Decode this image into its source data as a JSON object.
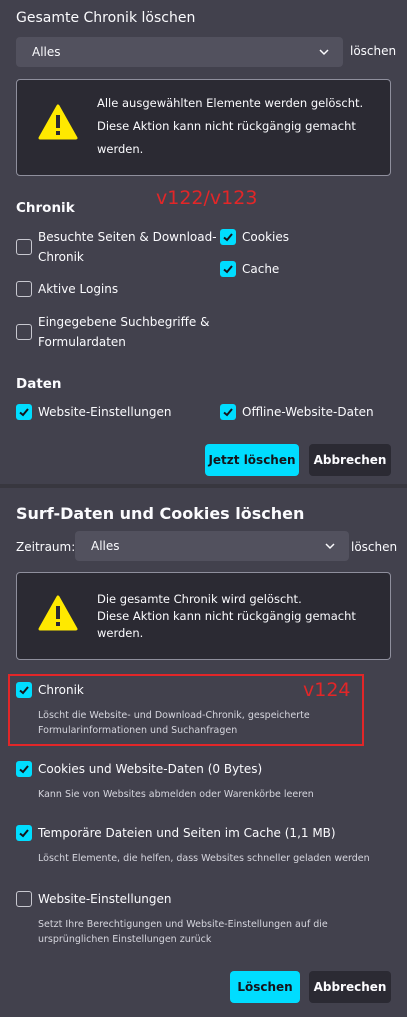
{
  "old_dialog": {
    "title": "Gesamte Chronik löschen",
    "range_value": "Alles",
    "range_suffix": "löschen",
    "warning_line1": "Alle ausgewählten Elemente werden gelöscht.",
    "warning_line2": "Diese Aktion kann nicht rückgängig gemacht",
    "warning_line3": "werden.",
    "version_tag": "v122/v123",
    "history_section": "Chronik",
    "items": [
      {
        "label_line1": "Besuchte Seiten & Download-",
        "label_line2": "Chronik",
        "checked": false
      },
      {
        "label_line1": "Aktive Logins",
        "label_line2": "",
        "checked": false
      },
      {
        "label_line1": "Eingegebene Suchbegriffe &",
        "label_line2": "Formulardaten",
        "checked": false
      },
      {
        "label_line1": "Cookies",
        "label_line2": "",
        "checked": true
      },
      {
        "label_line1": "Cache",
        "label_line2": "",
        "checked": true
      }
    ],
    "data_section": "Daten",
    "data_items": [
      {
        "label": "Website-Einstellungen",
        "checked": true
      },
      {
        "label": "Offline-Website-Daten",
        "checked": true
      }
    ],
    "confirm_button": "Jetzt löschen",
    "cancel_button": "Abbrechen"
  },
  "new_dialog": {
    "title": "Surf-Daten und Cookies löschen",
    "range_label": "Zeitraum:",
    "range_value": "Alles",
    "range_suffix": "löschen",
    "warning_line1": "Die gesamte Chronik wird gelöscht.",
    "warning_line2": "Diese Aktion kann nicht rückgängig gemacht",
    "warning_line3": "werden.",
    "version_tag": "v124",
    "options": [
      {
        "label": "Chronik",
        "desc_line1": "Löscht die Website- und Download-Chronik, gespeicherte",
        "desc_line2": "Formularinformationen und Suchanfragen",
        "checked": true
      },
      {
        "label": "Cookies und Website-Daten (0 Bytes)",
        "desc_line1": "Kann Sie von Websites abmelden oder Warenkörbe leeren",
        "desc_line2": "",
        "checked": true
      },
      {
        "label": "Temporäre Dateien und Seiten im Cache (1,1 MB)",
        "desc_line1": "Löscht Elemente, die helfen, dass Websites schneller geladen werden",
        "desc_line2": "",
        "checked": true
      },
      {
        "label": "Website-Einstellungen",
        "desc_line1": "Setzt Ihre Berechtigungen und Website-Einstellungen auf die",
        "desc_line2": "ursprünglichen Einstellungen zurück",
        "checked": false
      }
    ],
    "confirm_button": "Löschen",
    "cancel_button": "Abbrechen"
  },
  "colors": {
    "accent": "#00ddff",
    "background": "#42414d",
    "annotation_red": "#e22628"
  }
}
